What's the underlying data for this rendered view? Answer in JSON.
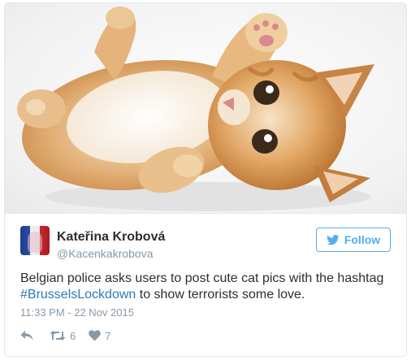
{
  "author": {
    "name": "Kateřina Krobová",
    "handle": "@Kacenkakrobova"
  },
  "follow_label": "Follow",
  "tweet": {
    "text_before": "Belgian police asks users to post cute cat pics with the hashtag",
    "hashtag": "#BrusselsLockdown",
    "text_after": " to show terrorists some love."
  },
  "timestamp": "11:33 PM - 22 Nov 2015",
  "stats": {
    "retweets": "6",
    "likes": "7"
  },
  "colors": {
    "brand_blue": "#55acee",
    "link_blue": "#2b7bb9",
    "text": "#292f33",
    "muted": "#8899a6"
  },
  "icons": [
    "bird-icon",
    "reply-icon",
    "retweet-icon",
    "heart-icon"
  ]
}
